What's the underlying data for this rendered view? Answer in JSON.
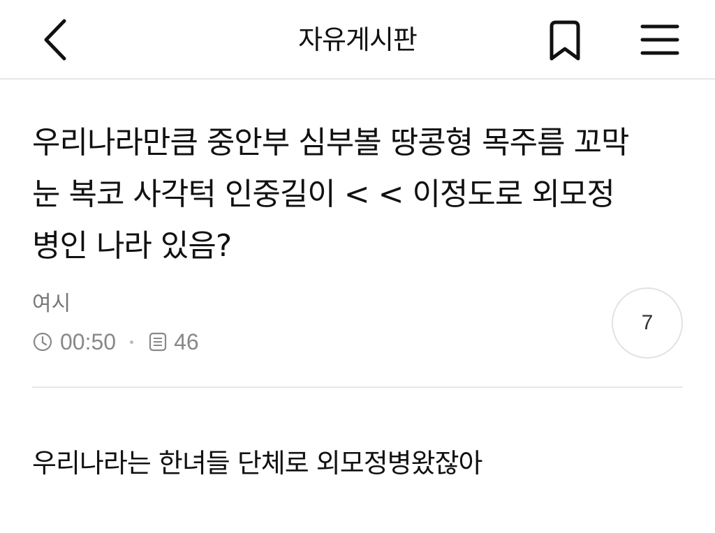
{
  "header": {
    "title": "자유게시판",
    "back_icon": "chevron-left-icon",
    "bookmark_icon": "bookmark-icon",
    "menu_icon": "hamburger-menu-icon"
  },
  "post": {
    "title": "우리나라만큼 중안부 심부볼 땅콩형 목주름 꼬막\n눈 복코 사각턱 인중길이  < <  이정도로 외모정\n병인 나라 있음?",
    "author": "여시",
    "time": "00:50",
    "views": "46",
    "comment_count": "7",
    "body": "우리나라는 한녀들 단체로 외모정병왔잖아"
  },
  "colors": {
    "text": "#111111",
    "muted": "#888888",
    "divider": "#e6e6e6"
  }
}
